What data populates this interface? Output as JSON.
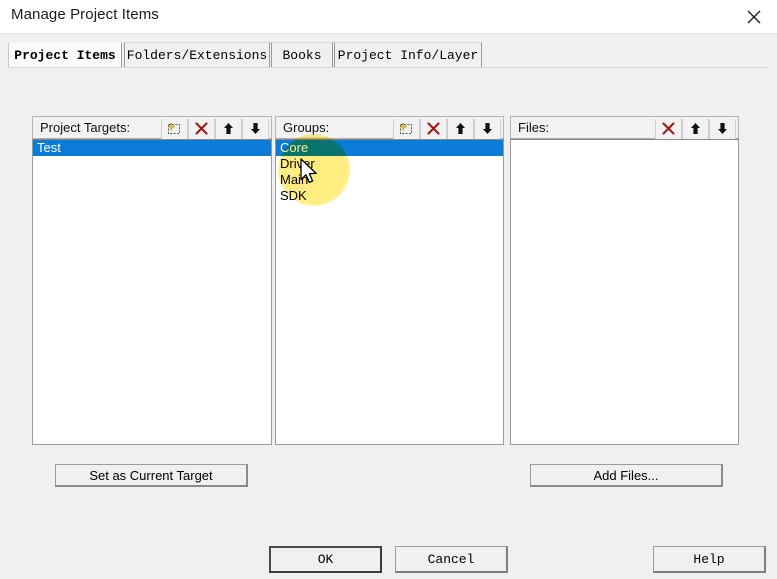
{
  "window": {
    "title": "Manage Project Items",
    "close_icon": "close-icon"
  },
  "tabs": [
    {
      "label": "Project Items",
      "active": true
    },
    {
      "label": "Folders/Extensions",
      "active": false
    },
    {
      "label": "Books",
      "active": false
    },
    {
      "label": "Project Info/Layer",
      "active": false
    }
  ],
  "panels": {
    "targets": {
      "label": "Project Targets:",
      "buttons": [
        "new-item-icon",
        "delete-icon",
        "move-up-icon",
        "move-down-icon"
      ],
      "items": [
        {
          "label": "Test",
          "selected": true
        }
      ]
    },
    "groups": {
      "label": "Groups:",
      "buttons": [
        "new-item-icon",
        "delete-icon",
        "move-up-icon",
        "move-down-icon"
      ],
      "items": [
        {
          "label": "Core",
          "selected": true
        },
        {
          "label": "Driver",
          "selected": false
        },
        {
          "label": "Main",
          "selected": false
        },
        {
          "label": "SDK",
          "selected": false
        }
      ]
    },
    "files": {
      "label": "Files:",
      "buttons": [
        "delete-icon",
        "move-up-icon",
        "move-down-icon"
      ],
      "items": []
    }
  },
  "actions": {
    "set_current_target": "Set as Current Target",
    "add_files": "Add Files..."
  },
  "footer": {
    "ok": "OK",
    "cancel": "Cancel",
    "help": "Help"
  },
  "colors": {
    "selection": "#0a7cd8",
    "dialog_bg": "#f0f0f0",
    "listbox_bg": "#ffffff",
    "delete_icon": "#a01818",
    "click_highlight": "#ffe860"
  }
}
